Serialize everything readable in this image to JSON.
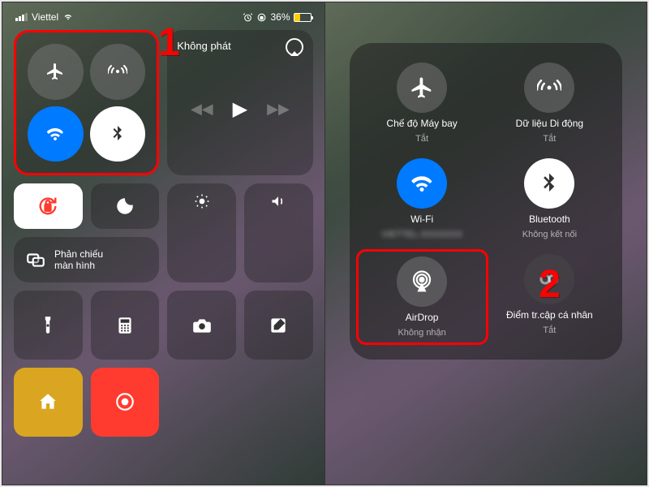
{
  "status": {
    "carrier": "Viettel",
    "battery_pct": "36%"
  },
  "media": {
    "title": "Không phát"
  },
  "mirror": {
    "line1": "Phản chiếu",
    "line2": "màn hình"
  },
  "expanded": {
    "airplane": {
      "label": "Chế độ Máy bay",
      "sub": "Tắt"
    },
    "cellular": {
      "label": "Dữ liệu Di động",
      "sub": "Tắt"
    },
    "wifi": {
      "label": "Wi-Fi",
      "sub": "VIETTEL-XXXXXXX"
    },
    "bluetooth": {
      "label": "Bluetooth",
      "sub": "Không kết nối"
    },
    "airdrop": {
      "label": "AirDrop",
      "sub": "Không nhận"
    },
    "hotspot": {
      "label": "Điểm tr.cập cá nhân",
      "sub": "Tắt"
    }
  },
  "annotations": {
    "one": "1",
    "two": "2"
  },
  "colors": {
    "accent_blue": "#007aff",
    "highlight": "#ff0000",
    "battery_low": "#ffcc00"
  }
}
